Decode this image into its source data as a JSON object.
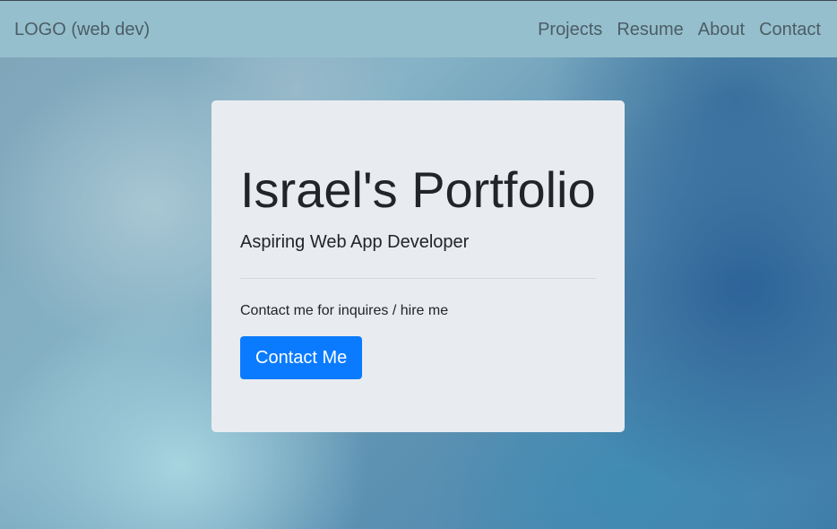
{
  "navbar": {
    "brand": "LOGO (web dev)",
    "links": [
      {
        "label": "Projects"
      },
      {
        "label": "Resume"
      },
      {
        "label": "About"
      },
      {
        "label": "Contact"
      }
    ]
  },
  "hero": {
    "title": "Israel's Portfolio",
    "subtitle": "Aspiring Web App Developer",
    "text": "Contact me for inquires / hire me",
    "button_label": "Contact Me"
  },
  "colors": {
    "navbar_bg": "#96bfcd",
    "card_bg": "#e8ecf0",
    "button_primary": "#0a7bff"
  }
}
